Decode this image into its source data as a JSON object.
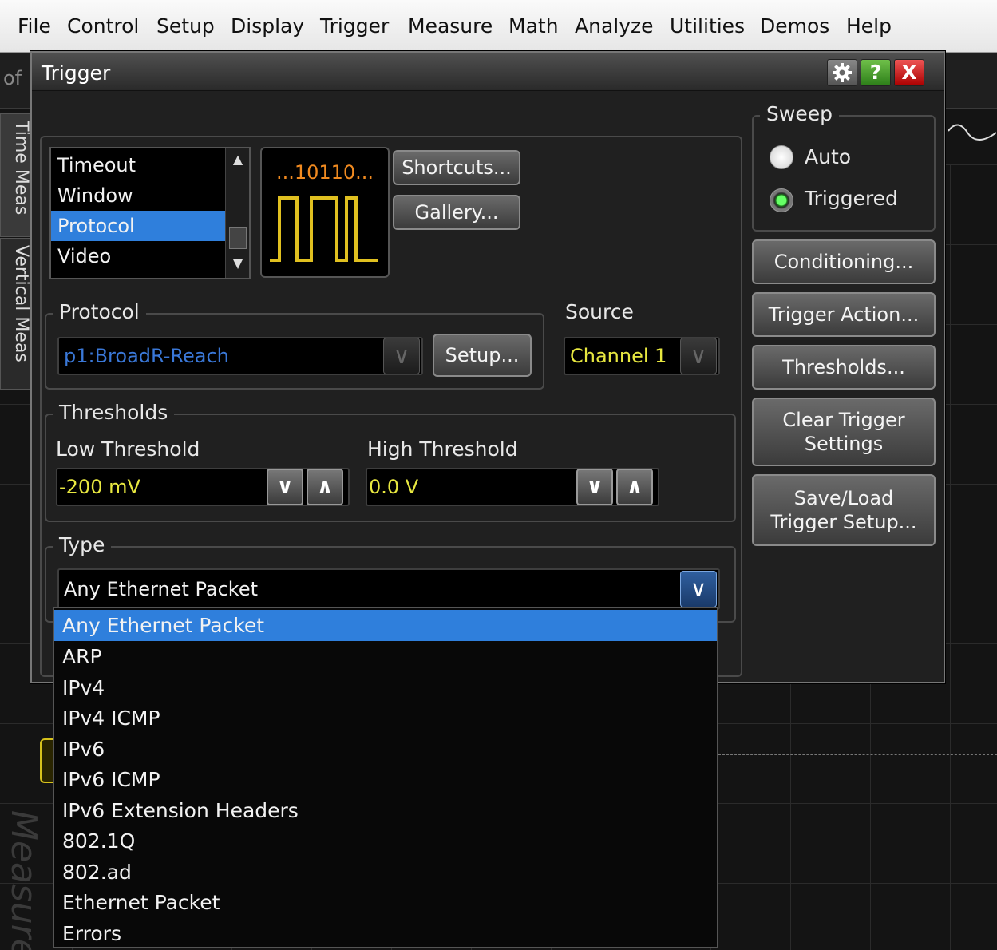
{
  "menubar": {
    "items": [
      "File",
      "Control",
      "Setup",
      "Display",
      "Trigger",
      "Measure",
      "Math",
      "Analyze",
      "Utilities",
      "Demos",
      "Help"
    ]
  },
  "background": {
    "of_fragment": "of",
    "tabs": [
      "Time Meas",
      "Vertical Meas"
    ],
    "measure_watermark": "Measure"
  },
  "dialog": {
    "title": "Trigger",
    "help_glyph": "?",
    "close_glyph": "X",
    "trigger_types": [
      "Timeout",
      "Window",
      "Protocol",
      "Video"
    ],
    "selected_trigger_type": "Protocol",
    "preview_bits": "...10110...",
    "shortcuts_label": "Shortcuts...",
    "gallery_label": "Gallery...",
    "protocol": {
      "group_label": "Protocol",
      "value": "p1:BroadR-Reach",
      "setup_label": "Setup..."
    },
    "source": {
      "label": "Source",
      "value": "Channel 1"
    },
    "thresholds": {
      "group_label": "Thresholds",
      "low_label": "Low Threshold",
      "low_value": "-200 mV",
      "high_label": "High Threshold",
      "high_value": "0.0 V"
    },
    "type": {
      "group_label": "Type",
      "value": "Any Ethernet Packet"
    },
    "sweep": {
      "group_label": "Sweep",
      "options": [
        "Auto",
        "Triggered"
      ],
      "selected": "Triggered"
    },
    "side_buttons": {
      "conditioning": "Conditioning...",
      "trigger_action": "Trigger Action...",
      "thresholds": "Thresholds...",
      "clear_line1": "Clear Trigger",
      "clear_line2": "Settings",
      "save_line1": "Save/Load",
      "save_line2": "Trigger Setup..."
    }
  },
  "type_dropdown": {
    "options": [
      "Any Ethernet Packet",
      "ARP",
      "IPv4",
      "IPv4 ICMP",
      "IPv6",
      "IPv6 ICMP",
      "IPv6 Extension Headers",
      "802.1Q",
      "802.ad",
      "Ethernet Packet",
      "Errors"
    ],
    "selected_index": 0
  },
  "colors": {
    "selection_blue": "#2f7fdc",
    "value_yellow": "#e8e840",
    "protocol_blue": "#3a78d8",
    "preview_wave": "#e0c020",
    "preview_bits": "#f08a20"
  }
}
